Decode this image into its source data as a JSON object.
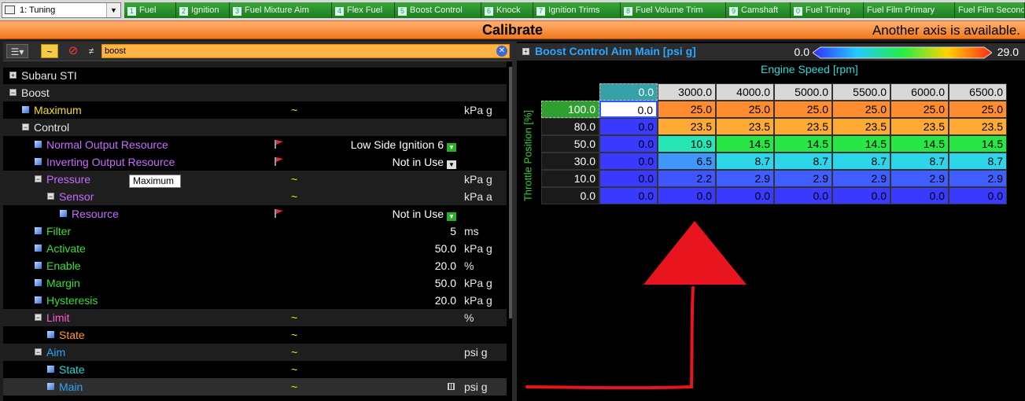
{
  "workspace": {
    "selected": "1: Tuning"
  },
  "tabs": [
    {
      "num": "1",
      "label": "Fuel"
    },
    {
      "num": "2",
      "label": "Ignition"
    },
    {
      "num": "3",
      "label": "Fuel Mixture Aim"
    },
    {
      "num": "4",
      "label": "Flex Fuel"
    },
    {
      "num": "5",
      "label": "Boost Control"
    },
    {
      "num": "6",
      "label": "Knock"
    },
    {
      "num": "7",
      "label": "Ignition Trims"
    },
    {
      "num": "8",
      "label": "Fuel Volume Trim"
    },
    {
      "num": "9",
      "label": "Camshaft"
    },
    {
      "num": "0",
      "label": "Fuel Timing"
    },
    {
      "num": "",
      "label": "Fuel Film Primary"
    },
    {
      "num": "",
      "label": "Fuel Film Seconda"
    }
  ],
  "calibrate": {
    "title": "Calibrate",
    "note": "Another axis is available."
  },
  "search": {
    "value": "boost"
  },
  "tooltip": "Maximum",
  "tree": [
    {
      "depth": 0,
      "type": "exp",
      "label": "Subaru STI",
      "color": "#e6e6e6",
      "band": false
    },
    {
      "depth": 0,
      "type": "exp",
      "label": "Boost",
      "color": "#e6e6e6",
      "band": true
    },
    {
      "depth": 1,
      "type": "leaf",
      "label": "Maximum",
      "color": "#f5e100",
      "value": "",
      "tilde": true,
      "unit": "kPa g",
      "band": false
    },
    {
      "depth": 1,
      "type": "exp",
      "label": "Control",
      "color": "#e6e6e6",
      "band": true
    },
    {
      "depth": 2,
      "type": "leaf",
      "label": "Normal Output Resource",
      "color": "#c56cff",
      "value": "Low Side Ignition 6",
      "flag": true,
      "dd": "green",
      "band": false
    },
    {
      "depth": 2,
      "type": "leaf",
      "label": "Inverting Output Resource",
      "color": "#c56cff",
      "value": "Not in Use",
      "flag": true,
      "dd": "white",
      "band": false
    },
    {
      "depth": 2,
      "type": "exp",
      "label": "Pressure",
      "color": "#c56cff",
      "tilde": true,
      "novalbg": true,
      "unit": "kPa g",
      "band": true
    },
    {
      "depth": 3,
      "type": "exp",
      "label": "Sensor",
      "color": "#c56cff",
      "tilde": true,
      "novalbg": true,
      "unit": "kPa a",
      "band": true
    },
    {
      "depth": 4,
      "type": "leaf",
      "label": "Resource",
      "color": "#c56cff",
      "value": "Not in Use",
      "flag": true,
      "dd": "green",
      "band": false
    },
    {
      "depth": 2,
      "type": "leaf",
      "label": "Filter",
      "color": "#35e035",
      "value": "5",
      "unit": "ms",
      "band": false
    },
    {
      "depth": 2,
      "type": "leaf",
      "label": "Activate",
      "color": "#35e035",
      "value": "50.0",
      "unit": "kPa g",
      "band": false
    },
    {
      "depth": 2,
      "type": "leaf",
      "label": "Enable",
      "color": "#35e035",
      "value": "20.0",
      "unit": "%",
      "band": false
    },
    {
      "depth": 2,
      "type": "leaf",
      "label": "Margin",
      "color": "#35e035",
      "value": "50.0",
      "unit": "kPa g",
      "band": false
    },
    {
      "depth": 2,
      "type": "leaf",
      "label": "Hysteresis",
      "color": "#35e035",
      "value": "20.0",
      "unit": "kPa g",
      "band": false
    },
    {
      "depth": 2,
      "type": "exp",
      "label": "Limit",
      "color": "#ff5ad0",
      "tilde": true,
      "novalbg": true,
      "unit": "%",
      "band": true
    },
    {
      "depth": 3,
      "type": "leaf",
      "label": "State",
      "color": "#ff9a2e",
      "value": "",
      "tilde": true,
      "band": false
    },
    {
      "depth": 2,
      "type": "exp",
      "label": "Aim",
      "color": "#2aa7ff",
      "tilde": true,
      "novalbg": true,
      "unit": "psi g",
      "band": true
    },
    {
      "depth": 3,
      "type": "leaf",
      "label": "State",
      "color": "#29d8d8",
      "value": "",
      "tilde": true,
      "band": false
    },
    {
      "depth": 3,
      "type": "leaf",
      "label": "Main",
      "color": "#2aa7ff",
      "value": "",
      "tilde": true,
      "novalbg": true,
      "gridicon": true,
      "unit": "psi g",
      "band": false,
      "sel": true
    }
  ],
  "table": {
    "title": "Boost Control Aim Main [psi g]",
    "color_min": "0.0",
    "color_max": "29.0",
    "x_axis_label": "Engine Speed [rpm]",
    "y_axis_label": "Throttle Position [%]",
    "x_values": [
      "0.0",
      "3000.0",
      "4000.0",
      "5000.0",
      "5500.0",
      "6000.0",
      "6500.0"
    ],
    "y_values": [
      "100.0",
      "80.0",
      "50.0",
      "30.0",
      "10.0",
      "0.0"
    ],
    "cells": [
      [
        "0.0",
        "25.0",
        "25.0",
        "25.0",
        "25.0",
        "25.0",
        "25.0"
      ],
      [
        "0.0",
        "23.5",
        "23.5",
        "23.5",
        "23.5",
        "23.5",
        "23.5"
      ],
      [
        "0.0",
        "10.9",
        "14.5",
        "14.5",
        "14.5",
        "14.5",
        "14.5"
      ],
      [
        "0.0",
        "6.5",
        "8.7",
        "8.7",
        "8.7",
        "8.7",
        "8.7"
      ],
      [
        "0.0",
        "2.2",
        "2.9",
        "2.9",
        "2.9",
        "2.9",
        "2.9"
      ],
      [
        "0.0",
        "0.0",
        "0.0",
        "0.0",
        "0.0",
        "0.0",
        "0.0"
      ]
    ]
  },
  "colors": {
    "accent_orange": "#f0781f",
    "tab_green": "#1f7d1f",
    "annotation_red": "#e8141e"
  }
}
